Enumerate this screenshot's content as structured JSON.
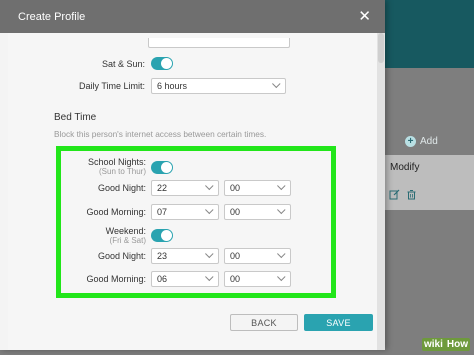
{
  "modal": {
    "title": "Create Profile",
    "close_icon": "close-icon"
  },
  "weekend_time": {
    "sat_sun_label": "Sat & Sun:",
    "sat_sun_enabled": true,
    "daily_limit_label": "Daily Time Limit:",
    "daily_limit_value": "6 hours"
  },
  "bed_time": {
    "title": "Bed Time",
    "description": "Block this person's internet access between certain times.",
    "school_nights_label": "School Nights:",
    "school_nights_sublabel": "(Sun to Thur)",
    "school_nights_enabled": true,
    "school_good_night_label": "Good Night:",
    "school_good_night_hour": "22",
    "school_good_night_min": "00",
    "school_good_morning_label": "Good Morning:",
    "school_good_morning_hour": "07",
    "school_good_morning_min": "00",
    "weekend_label": "Weekend:",
    "weekend_sublabel": "(Fri & Sat)",
    "weekend_enabled": true,
    "weekend_good_night_label": "Good Night:",
    "weekend_good_night_hour": "23",
    "weekend_good_night_min": "00",
    "weekend_good_morning_label": "Good Morning:",
    "weekend_good_morning_hour": "06",
    "weekend_good_morning_min": "00"
  },
  "buttons": {
    "back": "BACK",
    "save": "SAVE"
  },
  "background": {
    "add_label": "Add",
    "modify_label": "Modify"
  },
  "watermark": {
    "wiki": "wiki",
    "how": "How"
  },
  "colors": {
    "accent": "#2aa3b0",
    "highlight": "#22e61a"
  }
}
